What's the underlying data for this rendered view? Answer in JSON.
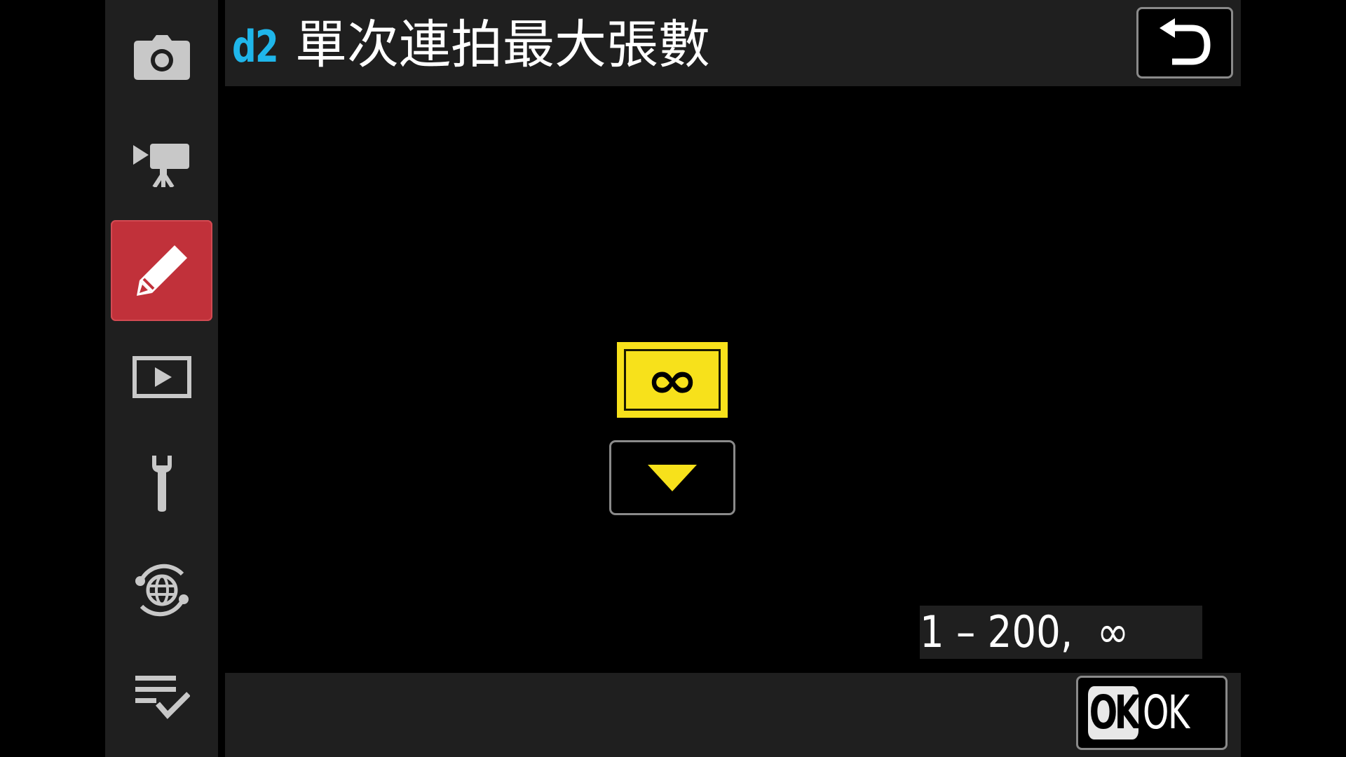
{
  "sidebar": {
    "items": [
      {
        "id": "photo-shooting",
        "icon": "camera-icon",
        "active": false
      },
      {
        "id": "video-recording",
        "icon": "movie-camera-icon",
        "active": false
      },
      {
        "id": "custom-settings",
        "icon": "pencil-icon",
        "active": true
      },
      {
        "id": "playback",
        "icon": "playback-icon",
        "active": false
      },
      {
        "id": "setup",
        "icon": "wrench-icon",
        "active": false
      },
      {
        "id": "network",
        "icon": "network-globe-icon",
        "active": false
      },
      {
        "id": "my-menu",
        "icon": "my-menu-checklist-icon",
        "active": false
      }
    ],
    "active_color": "#c1313a"
  },
  "header": {
    "code": "d2",
    "title": "單次連拍最大張數",
    "code_color": "#1fb6ea",
    "back_icon": "return-arrow-icon"
  },
  "selector": {
    "value": "∞",
    "highlight_color": "#f7e11b",
    "down_icon": "triangle-down-icon"
  },
  "range": {
    "text": "1 – 200,  ∞"
  },
  "footer": {
    "ok_badge": "OK",
    "ok_label": "OK"
  }
}
